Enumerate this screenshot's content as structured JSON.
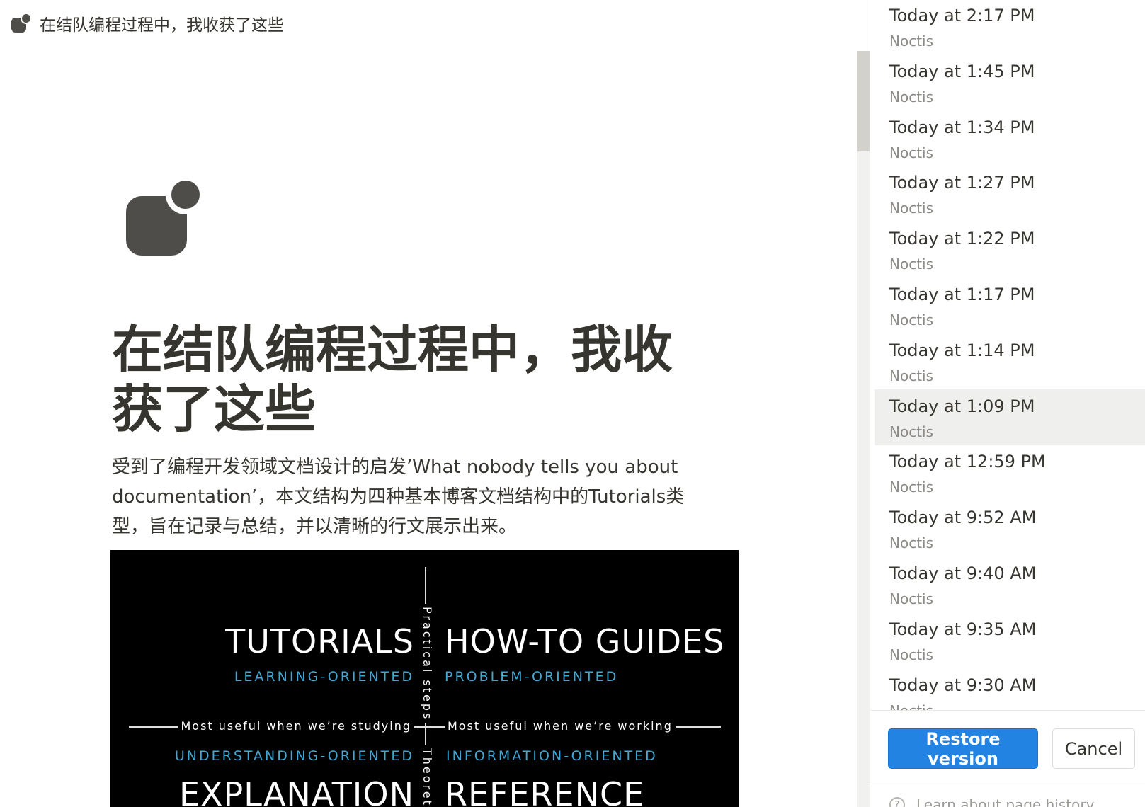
{
  "preview": {
    "breadcrumb_title": "在结队编程过程中，我收获了这些",
    "page_title": "在结队编程过程中，我收获了这些",
    "description": "受到了编程开发领域文档设计的启发’What nobody tells you about documentation’，本文结构为四种基本博客文档结构中的Tutorials类型，旨在记录与总结，并以清晰的行文展示出来。",
    "diagram": {
      "tutorials": "TUTORIALS",
      "tutorials_sub": "LEARNING-ORIENTED",
      "howto": "HOW-TO GUIDES",
      "howto_sub": "PROBLEM-ORIENTED",
      "explanation": "EXPLANATION",
      "explanation_sub": "UNDERSTANDING-ORIENTED",
      "reference": "REFERENCE",
      "reference_sub": "INFORMATION-ORIENTED",
      "studying": "Most useful when we’re studying",
      "working": "Most useful when we’re working",
      "practical": "Practical steps",
      "theoretical": "Theoretic"
    }
  },
  "history": {
    "versions": [
      {
        "time": "Today at 2:17 PM",
        "author": "Noctis"
      },
      {
        "time": "Today at 1:45 PM",
        "author": "Noctis"
      },
      {
        "time": "Today at 1:34 PM",
        "author": "Noctis"
      },
      {
        "time": "Today at 1:27 PM",
        "author": "Noctis"
      },
      {
        "time": "Today at 1:22 PM",
        "author": "Noctis"
      },
      {
        "time": "Today at 1:17 PM",
        "author": "Noctis"
      },
      {
        "time": "Today at 1:14 PM",
        "author": "Noctis"
      },
      {
        "time": "Today at 1:09 PM",
        "author": "Noctis"
      },
      {
        "time": "Today at 12:59 PM",
        "author": "Noctis"
      },
      {
        "time": "Today at 9:52 AM",
        "author": "Noctis"
      },
      {
        "time": "Today at 9:40 AM",
        "author": "Noctis"
      },
      {
        "time": "Today at 9:35 AM",
        "author": "Noctis"
      },
      {
        "time": "Today at 9:30 AM",
        "author": "Noctis"
      }
    ],
    "selected_index": 7,
    "restore_label": "Restore version",
    "cancel_label": "Cancel",
    "help_label": "Learn about page history",
    "help_icon": "?"
  },
  "colors": {
    "accent": "#2383e2",
    "diagram_sub": "#3fa9d6",
    "selected_bg": "#efefee"
  }
}
